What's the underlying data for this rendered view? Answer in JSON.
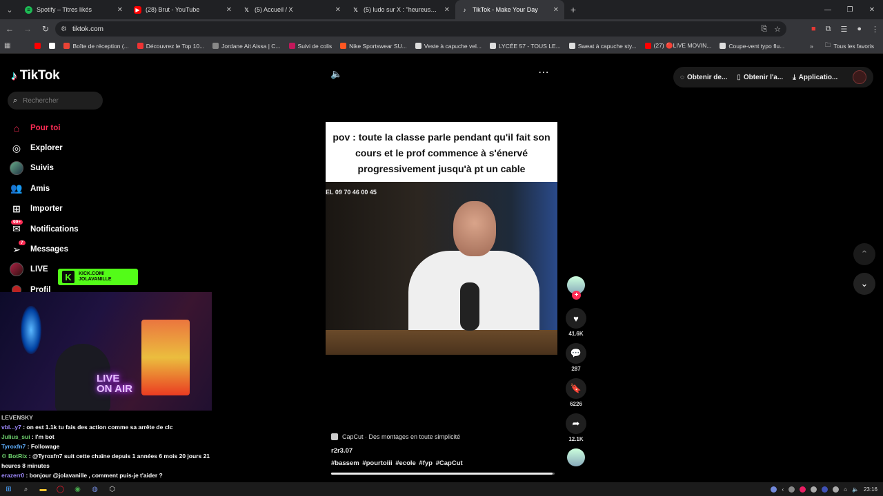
{
  "browser": {
    "tabs": [
      {
        "title": "Spotify – Titres likés",
        "icon_color": "#1db954",
        "icon": "spotify-icon",
        "active": false
      },
      {
        "title": "(28) Brut - YouTube",
        "icon_color": "#ff0000",
        "icon": "youtube-icon",
        "active": false
      },
      {
        "title": "(5) Accueil / X",
        "icon_color": "#ffffff",
        "icon": "x-icon",
        "active": false
      },
      {
        "title": "(5) ludo sur X : \"heureusement",
        "icon_color": "#ffffff",
        "icon": "x-icon",
        "active": false
      },
      {
        "title": "TikTok - Make Your Day",
        "icon_color": "#ffffff",
        "icon": "tiktok-icon",
        "active": true
      }
    ],
    "url": "tiktok.com",
    "bookmarks": [
      {
        "label": "",
        "color": "#ff0000"
      },
      {
        "label": "",
        "color": "#ffffff"
      },
      {
        "label": "Boîte de réception (...",
        "color": "#ea4335"
      },
      {
        "label": "Découvrez le Top 10...",
        "color": "#e33"
      },
      {
        "label": "Jordane Ait Aissa | C...",
        "color": "#888"
      },
      {
        "label": "Suivi de colis",
        "color": "#c2185b"
      },
      {
        "label": "Nike Sportswear SU...",
        "color": "#ff5722"
      },
      {
        "label": "Veste à capuche vel...",
        "color": "#ddd"
      },
      {
        "label": "LYCÉE 57 - TOUS LE...",
        "color": "#ddd"
      },
      {
        "label": "Sweat à capuche sty...",
        "color": "#ddd"
      },
      {
        "label": "(27) 🔴LIVE MOVIN...",
        "color": "#ff0000"
      },
      {
        "label": "Coupe-vent typo flu...",
        "color": "#ddd"
      }
    ],
    "all_bookmarks": "Tous les favoris"
  },
  "tiktok": {
    "logo": "TikTok",
    "search_placeholder": "Rechercher",
    "nav": [
      {
        "label": "Pour toi",
        "icon": "home-icon",
        "active": true
      },
      {
        "label": "Explorer",
        "icon": "compass-icon"
      },
      {
        "label": "Suivis",
        "icon": "following-avatar"
      },
      {
        "label": "Amis",
        "icon": "friends-icon"
      },
      {
        "label": "Importer",
        "icon": "upload-icon"
      },
      {
        "label": "Notifications",
        "icon": "inbox-icon",
        "badge": "99+"
      },
      {
        "label": "Messages",
        "icon": "send-icon",
        "badge": "7"
      },
      {
        "label": "LIVE",
        "icon": "live-icon"
      },
      {
        "label": "Profil",
        "icon": "profile-avatar"
      }
    ],
    "top_actions": [
      {
        "label": "Obtenir de...",
        "icon": "coin-icon"
      },
      {
        "label": "Obtenir l'a...",
        "icon": "phone-icon"
      },
      {
        "label": "Applicatio...",
        "icon": "download-icon"
      }
    ],
    "video": {
      "caption": "pov : toute la classe parle pendant qu'il fait son cours et le prof commence à s'énervé progressivement jusqu'à pt un cable",
      "phone_text": "EL  09 70 46 00 45",
      "likes": "41.6K",
      "comments": "287",
      "saves": "6226",
      "shares": "12.1K",
      "capcut_label": "CapCut · Des montages en toute simplicité",
      "author": "r2r3.07",
      "tags": "#bassem #pourtoiii #ecole #fyp #CapCut",
      "progress": 0.99
    }
  },
  "stream": {
    "kick_line1": "KICK.COM/",
    "kick_line2": "JOLAVANILLE",
    "neon_line1": "LIVE",
    "neon_line2": "ON AIR",
    "chat": [
      {
        "user": "LEVENSKY",
        "text": "",
        "cls": "dim"
      },
      {
        "user": "vbl...y7",
        "text": ": on est 1.1k tu fais des action comme sa arrête de clc",
        "cls": "u2"
      },
      {
        "user": "Julius_sui",
        "text": ": I'm bot",
        "cls": "u"
      },
      {
        "user": "Tyroxfn7",
        "text": ": Followage",
        "cls": "u3"
      },
      {
        "user": "⚙ BotRix",
        "text": ": @Tyroxfn7 suit cette chaîne depuis 1 années 6 mois 20 jours 21 heures 8 minutes",
        "cls": "u"
      },
      {
        "user": "erazerr0",
        "text": ": bonjour @jolavanille , comment puis-je t'aider ?",
        "cls": "u2"
      }
    ]
  },
  "taskbar": {
    "time": "23:16"
  }
}
